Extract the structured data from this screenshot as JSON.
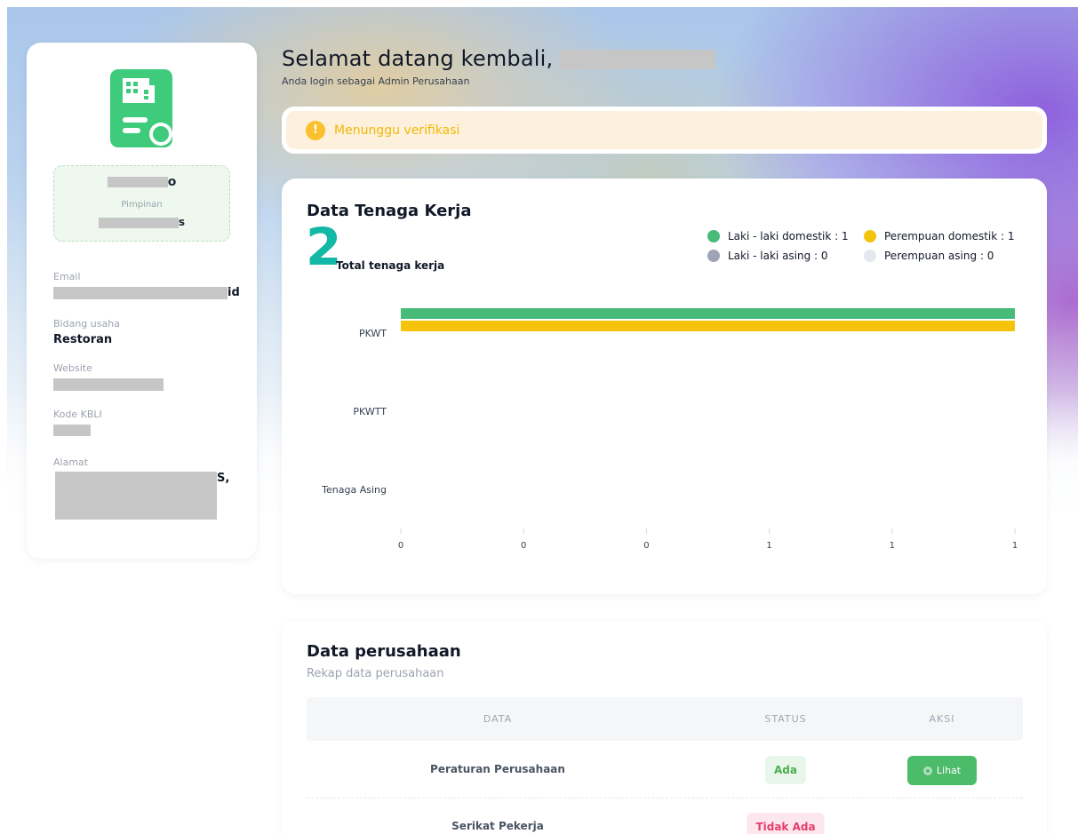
{
  "header": {
    "welcome": "Selamat datang kembali,",
    "login_as": "Anda login sebagai Admin Perusahaan"
  },
  "alert": {
    "icon": "exclamation-icon",
    "text": "Menunggu verifikasi"
  },
  "sidebar": {
    "company_icon": "building-certificate-icon",
    "name_suffix": "o",
    "leader_label": "Pimpinan",
    "leader_suffix": "s",
    "fields": {
      "email_label": "Email",
      "email_suffix": "id",
      "business_label": "Bidang usaha",
      "business_value": "Restoran",
      "website_label": "Website",
      "kbli_label": "Kode KBLI",
      "address_label": "Alamat",
      "address_suffix": "S,"
    }
  },
  "workforce": {
    "title": "Data Tenaga Kerja",
    "total": "2",
    "total_label": "Total tenaga kerja",
    "legend": [
      {
        "label": "Laki - laki domestik : 1",
        "color": "#48bb78"
      },
      {
        "label": "Perempuan domestik : 1",
        "color": "#f6c30c"
      },
      {
        "label": "Laki - laki asing : 0",
        "color": "#a0a5b5"
      },
      {
        "label": "Perempuan asing : 0",
        "color": "#e5e7f0"
      }
    ]
  },
  "chart_data": {
    "type": "bar",
    "orientation": "horizontal",
    "categories": [
      "PKWT",
      "PKWTT",
      "Tenaga Asing"
    ],
    "series": [
      {
        "name": "Laki - laki domestik",
        "color": "#48bb78",
        "values": [
          1,
          0,
          0
        ]
      },
      {
        "name": "Perempuan domestik",
        "color": "#f6c30c",
        "values": [
          1,
          0,
          0
        ]
      },
      {
        "name": "Laki - laki asing",
        "color": "#a0a5b5",
        "values": [
          0,
          0,
          0
        ]
      },
      {
        "name": "Perempuan asing",
        "color": "#e5e7f0",
        "values": [
          0,
          0,
          0
        ]
      }
    ],
    "x_tick_labels": [
      "0",
      "0",
      "0",
      "1",
      "1",
      "1"
    ],
    "xlim": [
      0,
      1
    ],
    "grid": false
  },
  "company_data": {
    "title": "Data perusahaan",
    "subtitle": "Rekap data perusahaan",
    "columns": [
      "DATA",
      "STATUS",
      "AKSI"
    ],
    "rows": [
      {
        "name": "Peraturan Perusahaan",
        "status": "Ada",
        "status_type": "ok",
        "action": "Lihat"
      },
      {
        "name": "Serikat Pekerja",
        "status": "Tidak Ada",
        "status_type": "no",
        "action": ""
      }
    ]
  }
}
